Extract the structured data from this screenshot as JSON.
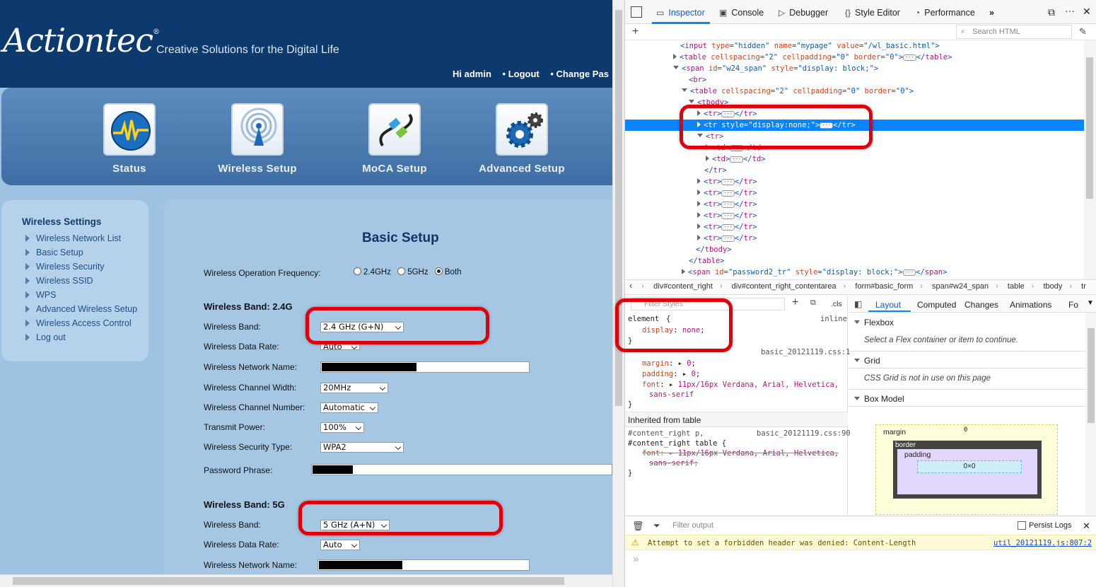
{
  "router": {
    "logo": "Actiontec",
    "tagline": "Creative Solutions for the Digital Life",
    "greeting": "Hi admin",
    "logout": "• Logout",
    "change_password": "• Change Pas",
    "nav": [
      {
        "label": "Status",
        "icon": "pulse-globe-icon"
      },
      {
        "label": "Wireless Setup",
        "icon": "wireless-tower-icon"
      },
      {
        "label": "MoCA Setup",
        "icon": "cable-plug-icon"
      },
      {
        "label": "Advanced Setup",
        "icon": "gears-icon"
      }
    ],
    "sidebar": {
      "title": "Wireless Settings",
      "items": [
        "Wireless Network List",
        "Basic Setup",
        "Wireless Security",
        "Wireless SSID",
        "WPS",
        "Advanced Wireless Setup",
        "Wireless Access Control",
        "Log out"
      ]
    },
    "page_title": "Basic Setup",
    "freq_label": "Wireless Operation Frequency:",
    "freq_options": [
      "2.4GHz",
      "5GHz",
      "Both"
    ],
    "freq_selected": "Both",
    "band24": {
      "title": "Wireless Band: 2.4G",
      "band_label": "Wireless Band:",
      "band_value": "2.4 GHz (G+N)",
      "rate_label": "Wireless Data Rate:",
      "rate_value": "Auto",
      "name_label": "Wireless Network Name:",
      "width_label": "Wireless Channel Width:",
      "width_value": "20MHz",
      "channel_label": "Wireless Channel Number:",
      "channel_value": "Automatic",
      "power_label": "Transmit Power:",
      "power_value": "100%",
      "security_label": "Wireless Security Type:",
      "security_value": "WPA2",
      "pass_label": "Password Phrase:"
    },
    "band5": {
      "title": "Wireless Band: 5G",
      "band_label": "Wireless Band:",
      "band_value": "5 GHz (A+N)",
      "rate_label": "Wireless Data Rate:",
      "rate_value": "Auto",
      "name_label": "Wireless Network Name:"
    }
  },
  "devtools": {
    "tabs": [
      {
        "label": "Inspector",
        "icon": "inspector-icon"
      },
      {
        "label": "Console",
        "icon": "console-icon"
      },
      {
        "label": "Debugger",
        "icon": "debugger-icon"
      },
      {
        "label": "Style Editor",
        "icon": "style-editor-icon"
      },
      {
        "label": "Performance",
        "icon": "performance-icon"
      }
    ],
    "search_placeholder": "Search HTML",
    "breadcrumbs": [
      "div#content_right",
      "div#content_right_contentarea",
      "form#basic_form",
      "span#w24_span",
      "table",
      "tbody",
      "tr"
    ],
    "rules": {
      "filter_placeholder": "Filter Styles",
      "cls_label": ".cls",
      "element_selector": "element",
      "element_source": "inline",
      "display_prop": "display",
      "display_value": "none",
      "rule2_source": "basic_20121119.css:1",
      "margin_prop": "margin",
      "margin_value": "0",
      "padding_prop": "padding",
      "padding_value": "0",
      "font_prop": "font",
      "font_value": "11px/16px Verdana, Arial, Helvetica,",
      "font_value2": "sans-serif",
      "inherited_label": "Inherited from table",
      "rule3_selector1": "#content_right p,",
      "rule3_selector2": "#content_right table",
      "rule3_source": "basic_20121119.css:90",
      "rule3_font": "font",
      "rule3_value": "11px/16px Verdana, Arial, Helvetica,",
      "rule3_value2": "sans-serif"
    },
    "layout_tabs": [
      "Layout",
      "Computed",
      "Changes",
      "Animations",
      "Fo"
    ],
    "flexbox": "Flexbox",
    "flexbox_note": "Select a Flex container or item to continue.",
    "grid": "Grid",
    "grid_note": "CSS Grid is not in use on this page",
    "boxmodel": "Box Model",
    "box": {
      "margin": "margin",
      "border": "border",
      "padding": "padding",
      "size": "0×0",
      "zero": "0"
    },
    "console": {
      "filter_placeholder": "Filter output",
      "persist": "Persist Logs",
      "warning": "Attempt to set a forbidden header was denied: Content-Length",
      "warning_source": "util_20121119.js:807:2",
      "prompt": "»"
    }
  }
}
